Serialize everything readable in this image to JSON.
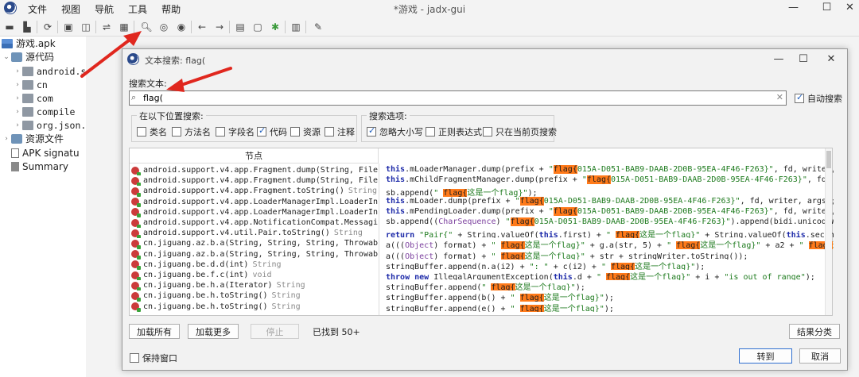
{
  "window": {
    "title": "*游戏 - jadx-gui",
    "menu": [
      "文件",
      "视图",
      "导航",
      "工具",
      "帮助"
    ],
    "controls": [
      "—",
      "☐",
      "✕"
    ]
  },
  "toolbar_icons": [
    "open-icon",
    "add-files-icon",
    "reload-icon",
    "save-icon",
    "save-all-icon",
    "sync-icon",
    "flat-packages-icon",
    "search-icon",
    "find-usage-icon",
    "find-class-icon",
    "back-icon",
    "forward-icon",
    "log-icon",
    "preferences-icon",
    "bug-icon",
    "deobfuscation-icon",
    "settings-icon"
  ],
  "tree": {
    "root": "游戏.apk",
    "source": "源代码",
    "packages": [
      "android.s",
      "cn",
      "com",
      "compile",
      "org.json."
    ],
    "resources": "资源文件",
    "signature": "APK signatu",
    "summary": "Summary"
  },
  "dialog": {
    "title": "文本搜索: flag(",
    "controls": [
      "—",
      "☐",
      "✕"
    ],
    "search_label": "搜索文本:",
    "search_value": "flag(",
    "auto_search_label": "自动搜索",
    "auto_search_checked": true,
    "search_in_label": "在以下位置搜索:",
    "search_in": [
      {
        "label": "类名",
        "checked": false
      },
      {
        "label": "方法名",
        "checked": false
      },
      {
        "label": "字段名",
        "checked": false
      },
      {
        "label": "代码",
        "checked": true
      },
      {
        "label": "资源",
        "checked": false
      },
      {
        "label": "注释",
        "checked": false
      }
    ],
    "options_label": "搜索选项:",
    "options": [
      {
        "label": "忽略大小写",
        "checked": true
      },
      {
        "label": "正则表达式",
        "checked": false
      },
      {
        "label": "只在当前页搜索",
        "checked": false
      }
    ],
    "column_header": "节点",
    "nodes": [
      {
        "name": "android.support.v4.app.Fragment.dump(String, FileDes",
        "ret": ""
      },
      {
        "name": "android.support.v4.app.Fragment.dump(String, FileDes",
        "ret": ""
      },
      {
        "name": "android.support.v4.app.Fragment.toString()",
        "ret": "String"
      },
      {
        "name": "android.support.v4.app.LoaderManagerImpl.LoaderInfo.",
        "ret": ""
      },
      {
        "name": "android.support.v4.app.LoaderManagerImpl.LoaderInfo.",
        "ret": ""
      },
      {
        "name": "android.support.v4.app.NotificationCompat.Messaging",
        "ret": ""
      },
      {
        "name": "android.support.v4.util.Pair.toString()",
        "ret": "String"
      },
      {
        "name": "cn.jiguang.az.b.a(String, String, String, Throwable",
        "ret": ""
      },
      {
        "name": "cn.jiguang.az.b.a(String, String, String, Throwable",
        "ret": ""
      },
      {
        "name": "cn.jiguang.be.d.d(int)",
        "ret": "String"
      },
      {
        "name": "cn.jiguang.be.f.c(int)",
        "ret": "void"
      },
      {
        "name": "cn.jiguang.be.h.a(Iterator)",
        "ret": "String"
      },
      {
        "name": "cn.jiguang.be.h.toString()",
        "ret": "String"
      },
      {
        "name": "cn.jiguang.be.h.toString()",
        "ret": "String"
      }
    ],
    "code_lines": [
      [
        [
          "kw",
          "this"
        ],
        [
          "t",
          ".mLoaderManager.dump(prefix + "
        ],
        [
          "str",
          "\""
        ],
        [
          "hl",
          "flag{"
        ],
        [
          "str",
          "015A-D051-BAB9-DAAB-2D0B-95EA-4F46-F263}\""
        ],
        [
          "t",
          ", fd, writer, args);"
        ]
      ],
      [
        [
          "kw",
          "this"
        ],
        [
          "t",
          ".mChildFragmentManager.dump(prefix + "
        ],
        [
          "str",
          "\""
        ],
        [
          "hl",
          "flag{"
        ],
        [
          "str",
          "015A-D051-BAB9-DAAB-2D0B-95EA-4F46-F263}\""
        ],
        [
          "t",
          ", fd, writer, args);"
        ]
      ],
      [
        [
          "t",
          "sb.append("
        ],
        [
          "str",
          "\" "
        ],
        [
          "hl",
          "flag{"
        ],
        [
          "str",
          "这是一个flag}\""
        ],
        [
          "t",
          ");"
        ]
      ],
      [
        [
          "kw",
          "this"
        ],
        [
          "t",
          ".mLoader.dump(prefix + "
        ],
        [
          "str",
          "\""
        ],
        [
          "hl",
          "flag{"
        ],
        [
          "str",
          "015A-D051-BAB9-DAAB-2D0B-95EA-4F46-F263}\""
        ],
        [
          "t",
          ", fd, writer, args);"
        ]
      ],
      [
        [
          "kw",
          "this"
        ],
        [
          "t",
          ".mPendingLoader.dump(prefix + "
        ],
        [
          "str",
          "\""
        ],
        [
          "hl",
          "flag{"
        ],
        [
          "str",
          "015A-D051-BAB9-DAAB-2D0B-95EA-4F46-F263}\""
        ],
        [
          "t",
          ", fd, writer, args);"
        ]
      ],
      [
        [
          "t",
          "sb.append(("
        ],
        [
          "ty",
          "CharSequence"
        ],
        [
          "t",
          ") "
        ],
        [
          "str",
          "\""
        ],
        [
          "hl",
          "flag{"
        ],
        [
          "str",
          "015A-D051-BAB9-DAAB-2D0B-95EA-4F46-F263}\""
        ],
        [
          "t",
          ").append(bidi.unicodeWrap(this.m"
        ]
      ],
      [
        [
          "kw",
          "return"
        ],
        [
          "str",
          " \"Pair{\""
        ],
        [
          "t",
          " + String.valueOf("
        ],
        [
          "kw",
          "this"
        ],
        [
          "t",
          ".first) + "
        ],
        [
          "str",
          "\" "
        ],
        [
          "hl",
          "flag{"
        ],
        [
          "str",
          "这是一个flag}\""
        ],
        [
          "t",
          " + String.valueOf("
        ],
        [
          "kw",
          "this"
        ],
        [
          "t",
          ".second) + "
        ],
        [
          "str",
          "\"}\""
        ],
        [
          "t",
          ";"
        ]
      ],
      [
        [
          "t",
          "a((("
        ],
        [
          "ty",
          "Object"
        ],
        [
          "t",
          ") format) + "
        ],
        [
          "str",
          "\" "
        ],
        [
          "hl",
          "flag{"
        ],
        [
          "str",
          "这是一个flag}\""
        ],
        [
          "t",
          " + g.a(str, 5) + "
        ],
        [
          "str",
          "\" "
        ],
        [
          "hl",
          "flag{"
        ],
        [
          "str",
          "这是一个flag}\""
        ],
        [
          "t",
          " + a2 + "
        ],
        [
          "str",
          "\" "
        ],
        [
          "hl",
          "flag{"
        ],
        [
          "str",
          "这是一个flag}\""
        ]
      ],
      [
        [
          "t",
          "a((("
        ],
        [
          "ty",
          "Object"
        ],
        [
          "t",
          ") format) + "
        ],
        [
          "str",
          "\" "
        ],
        [
          "hl",
          "flag{"
        ],
        [
          "str",
          "这是一个flag}\""
        ],
        [
          "t",
          " + str + stringWriter.toString());"
        ]
      ],
      [
        [
          "t",
          "stringBuffer.append(n.a(i2) + "
        ],
        [
          "str",
          "\": \""
        ],
        [
          "t",
          " + c(i2) + "
        ],
        [
          "str",
          "\" "
        ],
        [
          "hl",
          "flag{"
        ],
        [
          "str",
          "这是一个flag}\""
        ],
        [
          "t",
          ");"
        ]
      ],
      [
        [
          "kw",
          "throw new"
        ],
        [
          "t",
          " IllegalArgumentException("
        ],
        [
          "kw",
          "this"
        ],
        [
          "t",
          ".d + "
        ],
        [
          "str",
          "\" "
        ],
        [
          "hl",
          "flag{"
        ],
        [
          "str",
          "这是一个flag}\""
        ],
        [
          "t",
          " + i + "
        ],
        [
          "str",
          "\"is out of range\""
        ],
        [
          "t",
          ");"
        ]
      ],
      [
        [
          "t",
          "stringBuffer.append("
        ],
        [
          "str",
          "\" "
        ],
        [
          "hl",
          "flag{"
        ],
        [
          "str",
          "这是一个flag}\""
        ],
        [
          "t",
          ");"
        ]
      ],
      [
        [
          "t",
          "stringBuffer.append(b() + "
        ],
        [
          "str",
          "\" "
        ],
        [
          "hl",
          "flag{"
        ],
        [
          "str",
          "这是一个flag}\""
        ],
        [
          "t",
          ");"
        ]
      ],
      [
        [
          "t",
          "stringBuffer.append(e() + "
        ],
        [
          "str",
          "\" "
        ],
        [
          "hl",
          "flag{"
        ],
        [
          "str",
          "这是一个flag}\""
        ],
        [
          "t",
          ");"
        ]
      ]
    ],
    "buttons": {
      "load_all": "加载所有",
      "load_more": "加载更多",
      "stop": "停止",
      "found_text": "已找到  50+",
      "group_results": "结果分类",
      "keep_window": "保持窗口",
      "goto": "转到",
      "cancel": "取消"
    }
  },
  "colors": {
    "highlight": "#ff7a1a",
    "keyword": "#1c29a8",
    "string": "#1d7a1d",
    "annotation_arrow": "#e0271e"
  }
}
